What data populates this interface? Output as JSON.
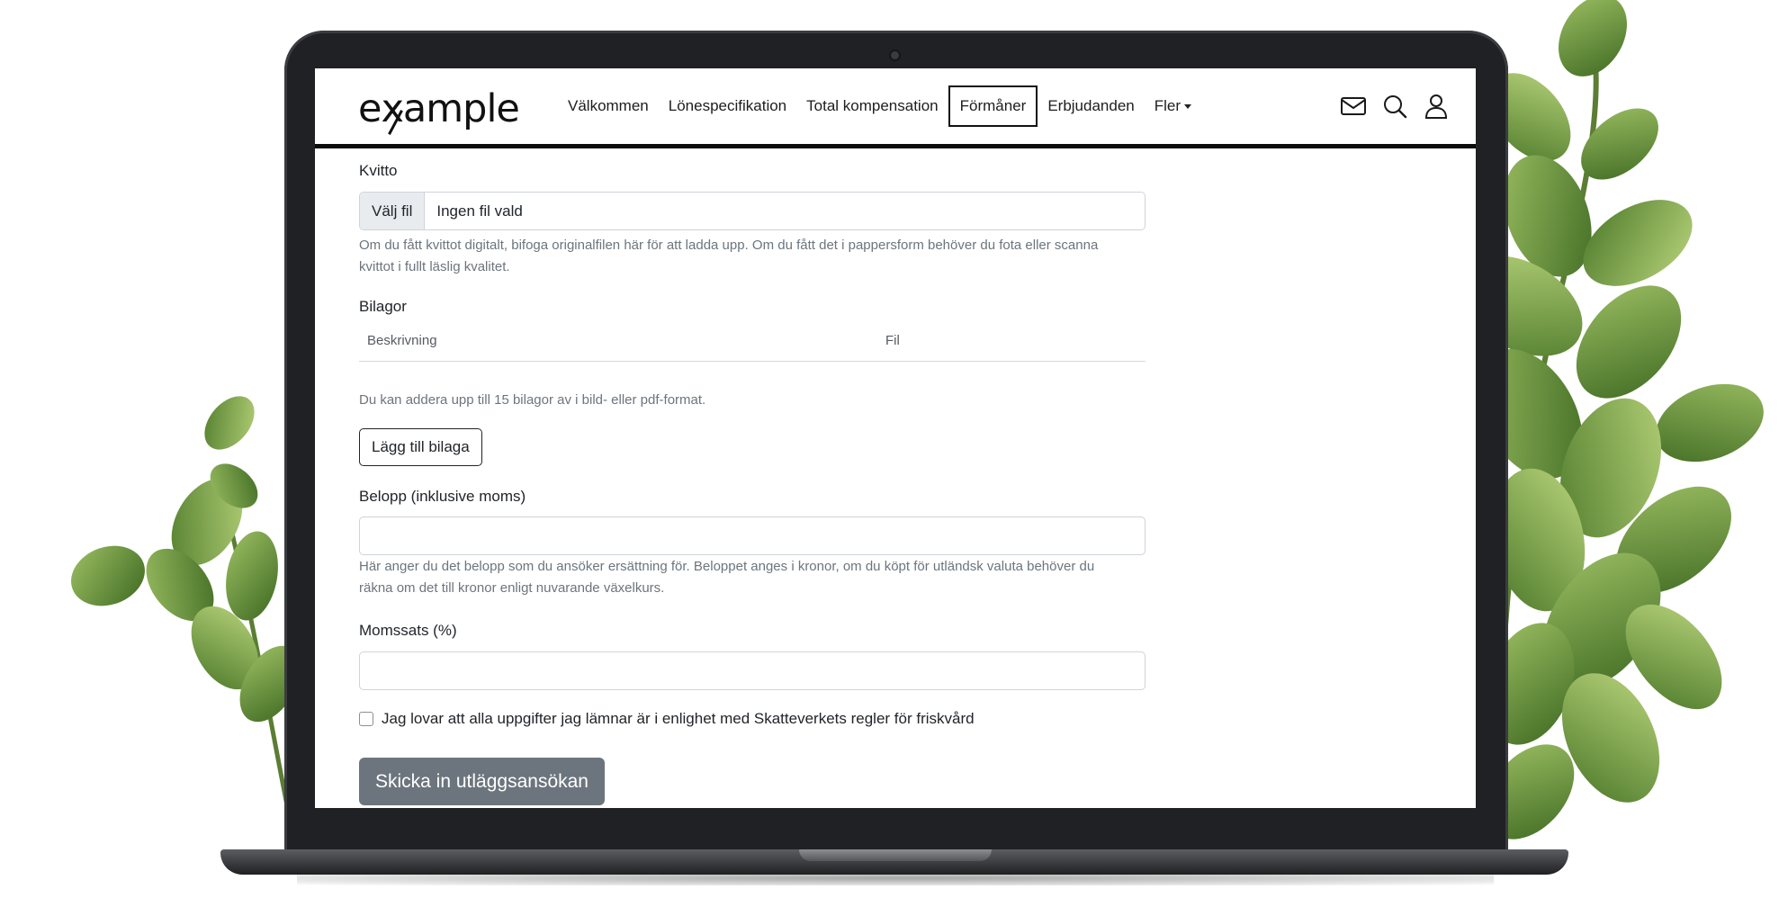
{
  "nav": {
    "logo": "example",
    "links": [
      {
        "label": "Välkommen"
      },
      {
        "label": "Lönespecifikation"
      },
      {
        "label": "Total kompensation"
      },
      {
        "label": "Förmåner"
      },
      {
        "label": "Erbjudanden"
      },
      {
        "label": "Fler"
      }
    ],
    "active_link": "Förmåner",
    "icons": [
      "mail-icon",
      "search-icon",
      "user-icon"
    ]
  },
  "form": {
    "receipt": {
      "label": "Kvitto",
      "button_label": "Välj fil",
      "file_status": "Ingen fil vald",
      "help_line1": "Om du fått kvittot digitalt, bifoga originalfilen här för att ladda upp. Om du fått det i pappersform behöver du fota eller scanna",
      "help_line2": "kvittot i fullt läslig kvalitet."
    },
    "attachments": {
      "label": "Bilagor",
      "columns": [
        "Beskrivning",
        "Fil"
      ],
      "help": "Du kan addera upp till 15 bilagor av i bild- eller pdf-format.",
      "add_button": "Lägg till bilaga"
    },
    "amount": {
      "label": "Belopp (inklusive moms)",
      "value": "",
      "help_line1": "Här anger du det belopp som du ansöker ersättning för. Beloppet anges i kronor, om du köpt för utländsk valuta behöver du",
      "help_line2": "räkna om det till kronor enligt nuvarande växelkurs."
    },
    "vat": {
      "label": "Momssats (%)",
      "value": ""
    },
    "consent": {
      "label": "Jag lovar att alla uppgifter jag lämnar är i enlighet med Skatteverkets regler för friskvård",
      "checked": false
    },
    "submit_label": "Skicka in utläggsansökan"
  },
  "colors": {
    "submit_bg": "#6c757d",
    "help_text": "#6c757d",
    "leaf_dark": "#4f7a2c",
    "leaf_light": "#8fb45a"
  }
}
